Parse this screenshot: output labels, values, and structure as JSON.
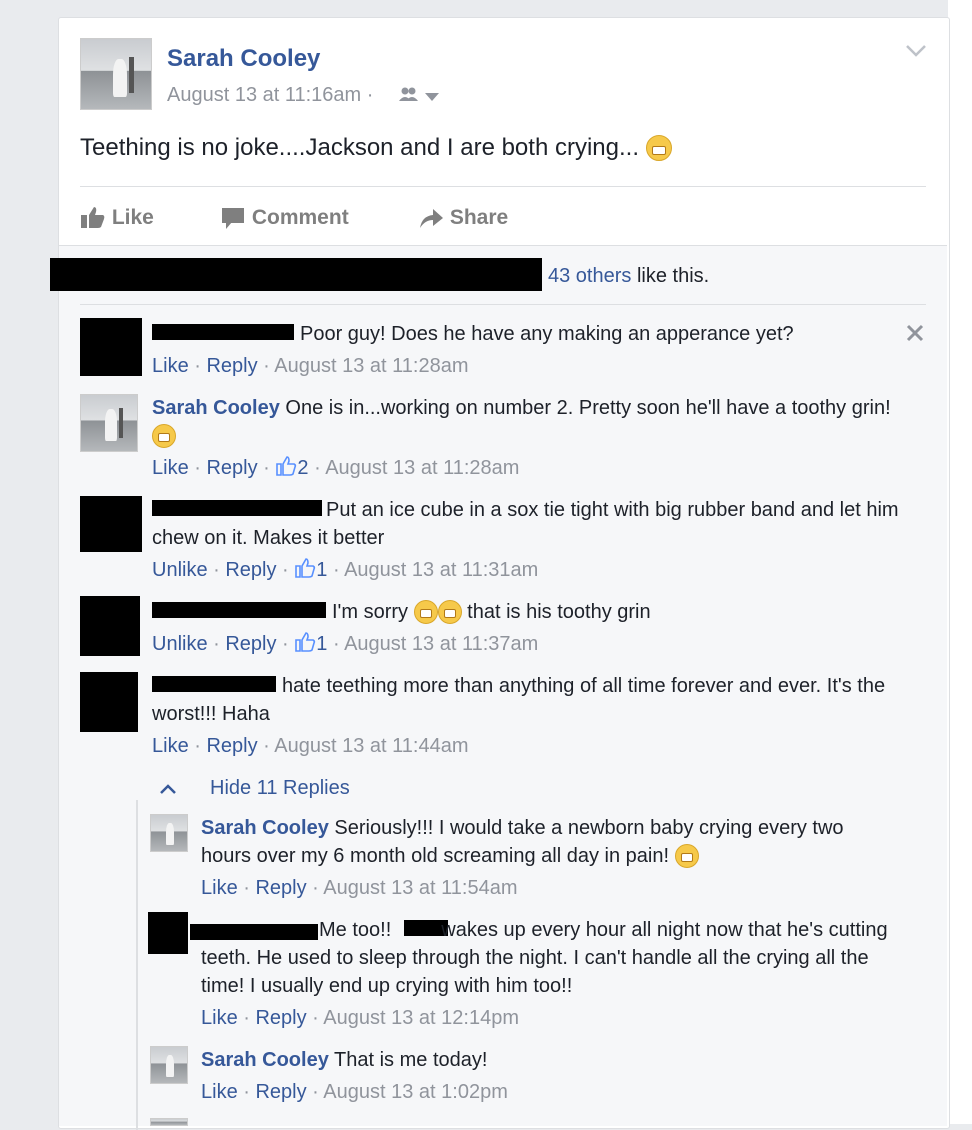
{
  "post": {
    "author": "Sarah Cooley",
    "time": "August 13 at 11:16am",
    "dot": "·",
    "text": "Teething is no joke....Jackson and I are both crying...",
    "emoji": "crying-face"
  },
  "actions": {
    "like": "Like",
    "comment": "Comment",
    "share": "Share"
  },
  "likes": {
    "others": "43 others",
    "suffix": "like this."
  },
  "comments": [
    {
      "author": "",
      "text": "Poor guy! Does he have any making an apperance yet?",
      "action": "Like",
      "reply": "Reply",
      "time": "August 13 at 11:28am"
    },
    {
      "author": "Sarah Cooley",
      "text": "One is in...working on number 2. Pretty soon he'll have a toothy grin!",
      "action": "Like",
      "reply": "Reply",
      "likes": "2",
      "time": "August 13 at 11:28am"
    },
    {
      "author": "",
      "text": "Put an ice cube in a sox tie tight with big rubber band and let him chew on it. Makes it better",
      "action": "Unlike",
      "reply": "Reply",
      "likes": "1",
      "time": "August 13 at 11:31am"
    },
    {
      "author": "",
      "text_a": "I'm sorry",
      "text_b": "that is his toothy grin",
      "action": "Unlike",
      "reply": "Reply",
      "likes": "1",
      "time": "August 13 at 11:37am"
    },
    {
      "author": "",
      "text": "hate teething more than anything of all time forever and ever. It's the worst!!! Haha",
      "action": "Like",
      "reply": "Reply",
      "time": "August 13 at 11:44am"
    }
  ],
  "replies_toggle": "Hide 11 Replies",
  "replies": [
    {
      "author": "Sarah Cooley",
      "text": "Seriously!!! I would take a newborn baby crying every two hours over my 6 month old screaming all day in pain!",
      "action": "Like",
      "reply": "Reply",
      "time": "August 13 at 11:54am"
    },
    {
      "author": "",
      "text_a": "Me too!!",
      "text_b": "wakes up every hour all night now that he's cutting teeth. He used to sleep through the night. I can't handle all the crying all the time! I usually end up crying with him too!!",
      "action": "Like",
      "reply": "Reply",
      "time": "August 13 at 12:14pm"
    },
    {
      "author": "Sarah Cooley",
      "text": "That is me today!",
      "action": "Like",
      "reply": "Reply",
      "time": "August 13 at 1:02pm"
    }
  ],
  "colors": {
    "link": "#365899",
    "meta": "#90949c",
    "text": "#1d2129"
  }
}
